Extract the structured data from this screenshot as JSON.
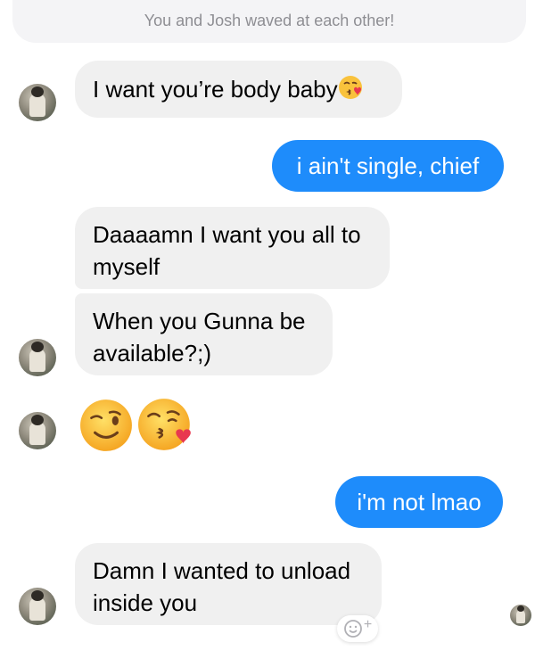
{
  "notice": {
    "text": "You and Josh waved at each other!"
  },
  "messages": [
    {
      "id": "m1",
      "text": "I want you’re body baby",
      "emoji": "kissing-face-with-heart-icon"
    },
    {
      "id": "m2",
      "text": "i ain't single, chief"
    },
    {
      "id": "m3",
      "text": "Daaaamn I want you all to myself"
    },
    {
      "id": "m4",
      "text": "When you Gunna be available?;)"
    },
    {
      "id": "m5",
      "emojis": [
        "winking-face-icon",
        "face-blowing-kiss-icon"
      ]
    },
    {
      "id": "m6",
      "text": "i'm not lmao"
    },
    {
      "id": "m7",
      "text": "Damn I wanted to unload inside you"
    }
  ],
  "reaction_button": {
    "icon": "add-reaction-icon",
    "label": "+"
  },
  "colors": {
    "outgoing": "#1e8cfb",
    "incoming": "#f0f0f0",
    "notice_text": "#8e8e93"
  }
}
